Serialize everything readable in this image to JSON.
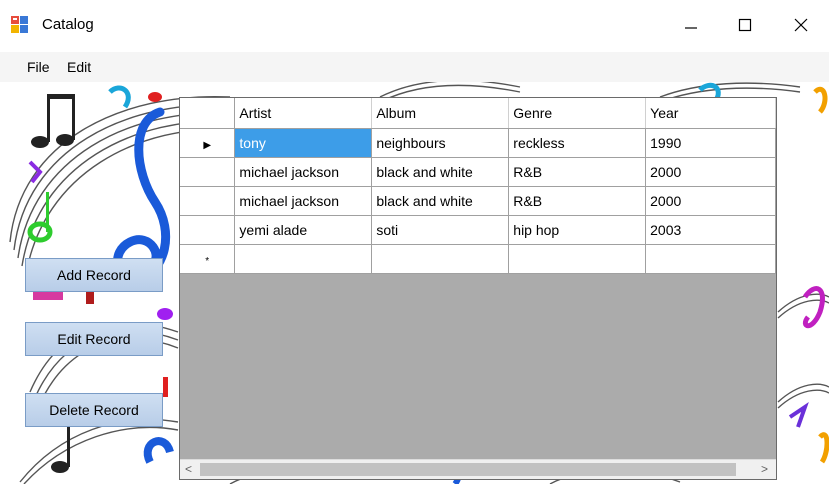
{
  "window": {
    "title": "Catalog",
    "minimize_glyph": "—",
    "maximize_glyph": "☐",
    "close_glyph": "✕"
  },
  "menu": {
    "items": [
      {
        "label": "File"
      },
      {
        "label": "Edit"
      }
    ]
  },
  "buttons": {
    "add": "Add Record",
    "edit": "Edit Record",
    "delete": "Delete Record"
  },
  "grid": {
    "columns": [
      "Artist",
      "Album",
      "Genre",
      "Year"
    ],
    "rows": [
      {
        "artist": "tony",
        "album": "neighbours",
        "genre": "reckless",
        "year": "1990"
      },
      {
        "artist": "michael jackson",
        "album": "black and white",
        "genre": "R&B",
        "year": "2000"
      },
      {
        "artist": "michael jackson",
        "album": "black and white",
        "genre": "R&B",
        "year": "2000"
      },
      {
        "artist": "yemi alade",
        "album": "soti",
        "genre": "hip hop",
        "year": "2003"
      }
    ],
    "current_row_marker": "▶",
    "new_row_marker": "*",
    "selected_cell": "artist of row 1",
    "scroll_left": "<",
    "scroll_right": ">"
  },
  "colors": {
    "selection": "#3d9de8",
    "button_fill": "#c4d7ee",
    "grid_background": "#ababab"
  },
  "icons": [
    "app-icon",
    "minimize-icon",
    "maximize-icon",
    "close-icon",
    "row-pointer-icon",
    "scroll-left-icon",
    "scroll-right-icon"
  ]
}
